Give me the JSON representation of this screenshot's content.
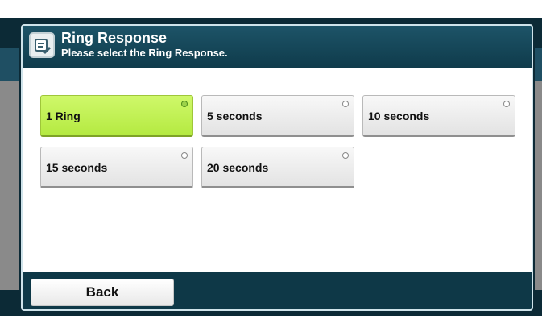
{
  "header": {
    "title": "Ring Response",
    "subtitle": "Please select the Ring Response.",
    "icon": "fax-settings-icon"
  },
  "options": [
    {
      "label": "1 Ring",
      "selected": true
    },
    {
      "label": "5 seconds",
      "selected": false
    },
    {
      "label": "10 seconds",
      "selected": false
    },
    {
      "label": "15 seconds",
      "selected": false
    },
    {
      "label": "20 seconds",
      "selected": false
    }
  ],
  "footer": {
    "back_label": "Back"
  },
  "colors": {
    "header_bg": "#0f3b4b",
    "selected_bg": "#c4f25a",
    "button_bg": "#eeeeee"
  }
}
